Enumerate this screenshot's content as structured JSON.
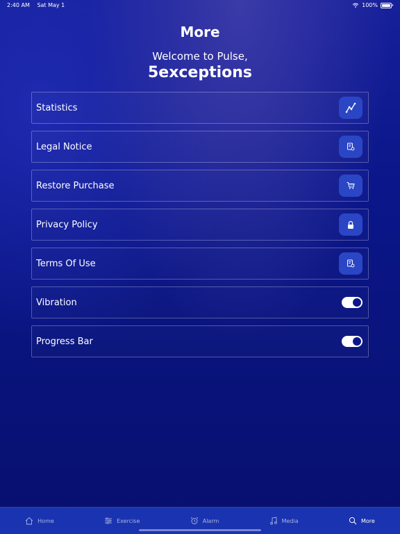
{
  "status_bar": {
    "time": "2:40 AM",
    "date": "Sat May 1",
    "battery": "100%"
  },
  "header": {
    "title": "More",
    "welcome": "Welcome to Pulse,",
    "username": "5exceptions"
  },
  "settings": [
    {
      "label": "Statistics",
      "kind": "icon",
      "icon": "chart-line-icon"
    },
    {
      "label": "Legal Notice",
      "kind": "icon",
      "icon": "document-icon"
    },
    {
      "label": "Restore Purchase",
      "kind": "icon",
      "icon": "cart-icon"
    },
    {
      "label": "Privacy Policy",
      "kind": "icon",
      "icon": "lock-icon"
    },
    {
      "label": "Terms Of Use",
      "kind": "icon",
      "icon": "document-icon"
    },
    {
      "label": "Vibration",
      "kind": "toggle",
      "on": true
    },
    {
      "label": "Progress Bar",
      "kind": "toggle",
      "on": true
    }
  ],
  "tabs": [
    {
      "label": "Home",
      "icon": "home-icon"
    },
    {
      "label": "Exercise",
      "icon": "exercise-icon"
    },
    {
      "label": "Alarm",
      "icon": "alarm-icon"
    },
    {
      "label": "Media",
      "icon": "music-note-icon"
    },
    {
      "label": "More",
      "icon": "search-icon",
      "active": true
    }
  ],
  "colors": {
    "accent": "#2a46c4",
    "tab_bar": "#1a33b0",
    "background": "#0b168a"
  }
}
